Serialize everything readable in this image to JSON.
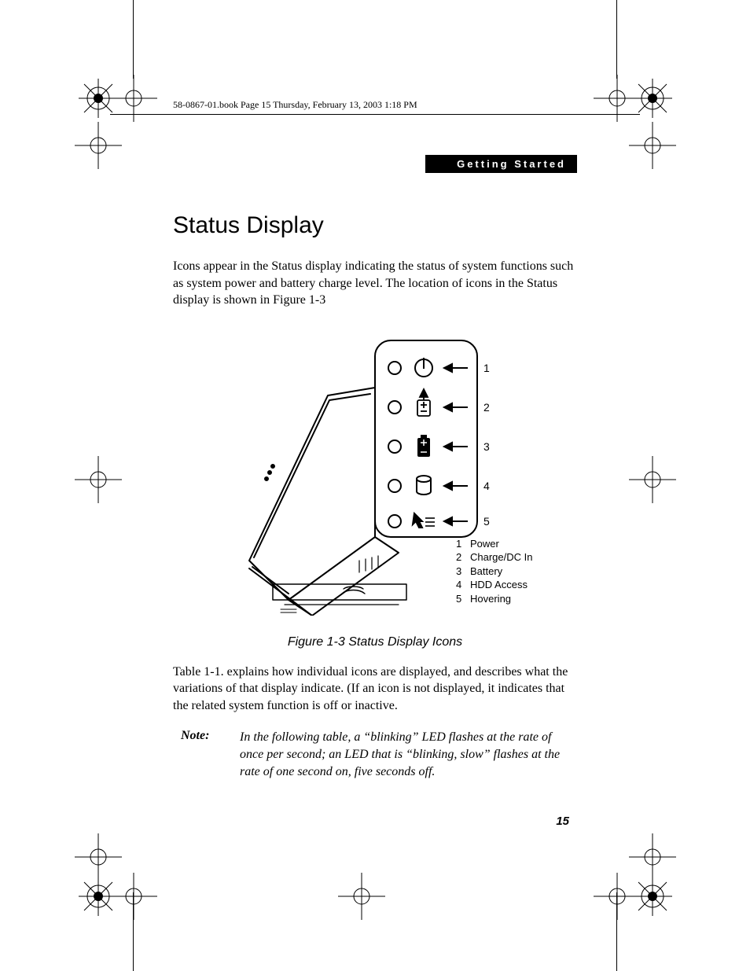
{
  "header_line": "58-0867-01.book  Page 15  Thursday, February 13, 2003  1:18 PM",
  "section_label": "Getting Started",
  "title": "Status Display",
  "intro": "Icons appear in the Status display indicating the status of system functions such as system power and battery charge level. The location of icons in the Status display is shown in Figure 1-3",
  "callouts": {
    "r1": "1",
    "r2": "2",
    "r3": "3",
    "r4": "4",
    "r5": "5"
  },
  "legend": [
    {
      "num": "1",
      "label": "Power"
    },
    {
      "num": "2",
      "label": "Charge/DC In"
    },
    {
      "num": "3",
      "label": "Battery"
    },
    {
      "num": "4",
      "label": "HDD Access"
    },
    {
      "num": "5",
      "label": "Hovering"
    }
  ],
  "figure_caption": "Figure 1-3  Status Display Icons",
  "after_figure": "Table 1-1. explains how individual icons are displayed, and describes what the variations of that display indicate. (If an icon is not displayed, it indicates that the related system function is off or inactive.",
  "note_label": "Note:",
  "note_text": "In the following table, a “blinking” LED flashes at the rate of once per second; an LED that is “blinking, slow” flashes at the rate of one second on, five seconds off.",
  "page_number": "15"
}
